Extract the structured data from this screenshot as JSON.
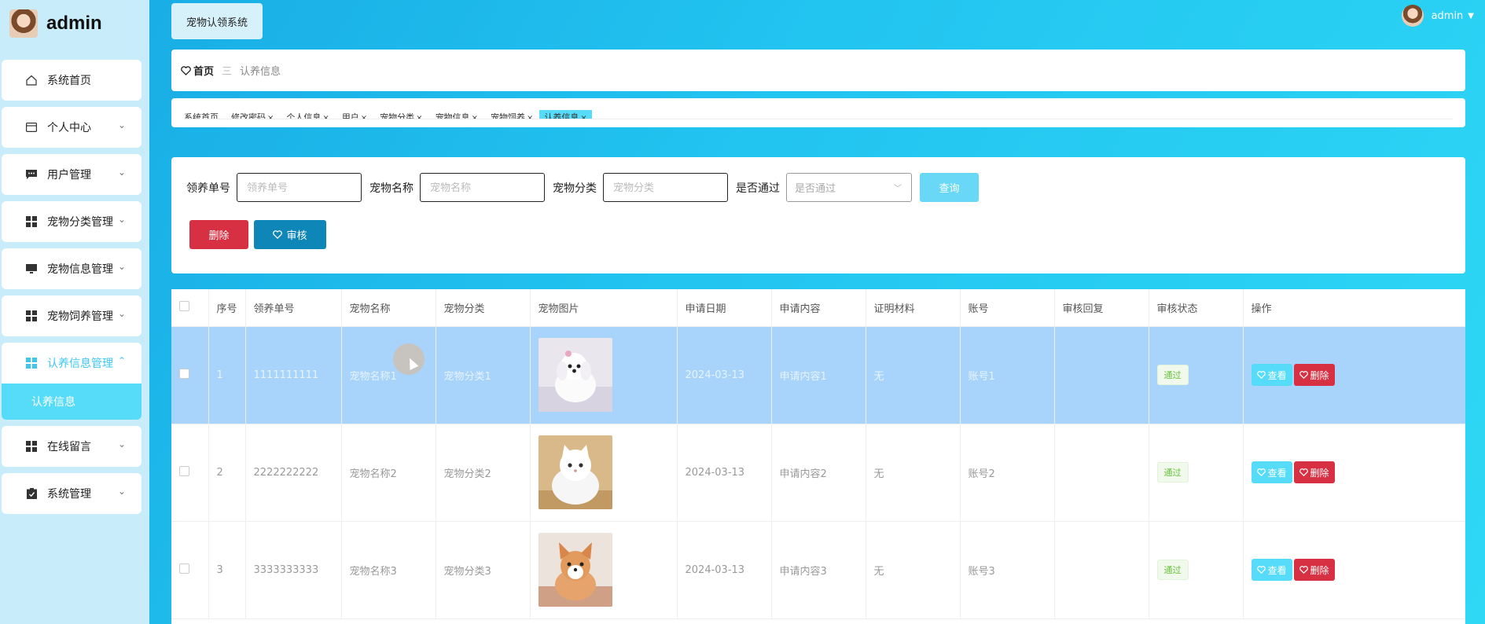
{
  "brand": {
    "title": "admin"
  },
  "sidebar": {
    "items": [
      {
        "label": "系统首页",
        "icon": "home-icon"
      },
      {
        "label": "个人中心",
        "icon": "card-icon"
      },
      {
        "label": "用户管理",
        "icon": "chat-icon"
      },
      {
        "label": "宠物分类管理",
        "icon": "grid-icon"
      },
      {
        "label": "宠物信息管理",
        "icon": "monitor-icon"
      },
      {
        "label": "宠物饲养管理",
        "icon": "grid-icon"
      },
      {
        "label": "认养信息管理",
        "icon": "grid-icon",
        "active": true,
        "sub": [
          "认养信息"
        ]
      },
      {
        "label": "在线留言",
        "icon": "grid-icon"
      },
      {
        "label": "系统管理",
        "icon": "clipboard-icon"
      }
    ]
  },
  "header": {
    "system_name": "宠物认领系统",
    "username": "admin"
  },
  "breadcrumb": {
    "home": "首页",
    "separator": "三",
    "current": "认养信息"
  },
  "tabs": [
    "系统首页",
    "修改密码",
    "个人信息",
    "用户",
    "宠物分类",
    "宠物信息",
    "宠物饲养",
    "认养信息"
  ],
  "search": {
    "fields": [
      {
        "label": "领养单号",
        "placeholder": "领养单号"
      },
      {
        "label": "宠物名称",
        "placeholder": "宠物名称"
      },
      {
        "label": "宠物分类",
        "placeholder": "宠物分类"
      }
    ],
    "approve_label": "是否通过",
    "approve_placeholder": "是否通过",
    "query_button": "查询",
    "delete_button": "删除",
    "audit_button": "审核"
  },
  "table": {
    "columns": [
      "序号",
      "领养单号",
      "宠物名称",
      "宠物分类",
      "宠物图片",
      "申请日期",
      "申请内容",
      "证明材料",
      "账号",
      "审核回复",
      "审核状态",
      "操作"
    ],
    "rows": [
      {
        "index": "1",
        "order_no": "1111111111",
        "pet_name": "宠物名称1",
        "category": "宠物分类1",
        "date": "2024-03-13",
        "content": "申请内容1",
        "proof": "无",
        "account": "账号1",
        "reply": "",
        "status": "通过",
        "pet": "white-puppy"
      },
      {
        "index": "2",
        "order_no": "2222222222",
        "pet_name": "宠物名称2",
        "category": "宠物分类2",
        "date": "2024-03-13",
        "content": "申请内容2",
        "proof": "无",
        "account": "账号2",
        "reply": "",
        "status": "通过",
        "pet": "white-kitten"
      },
      {
        "index": "3",
        "order_no": "3333333333",
        "pet_name": "宠物名称3",
        "category": "宠物分类3",
        "date": "2024-03-13",
        "content": "申请内容3",
        "proof": "无",
        "account": "账号3",
        "reply": "",
        "status": "通过",
        "pet": "corgi-puppy"
      }
    ],
    "view_button": "查看",
    "delete_button": "删除"
  },
  "colors": {
    "accent": "#56dcf8",
    "danger": "#d63042",
    "primary": "#0f86b8",
    "selected_row": "#a8d4fb"
  }
}
